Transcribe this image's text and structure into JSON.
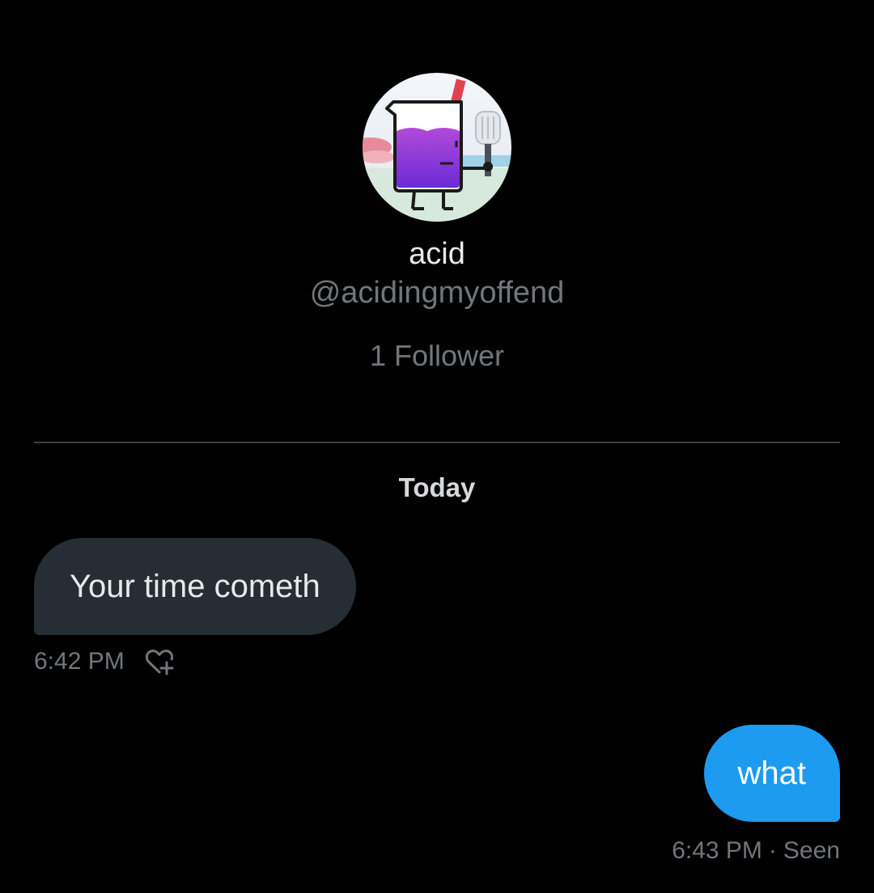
{
  "profile": {
    "avatar_icon": "beaker-character-avatar",
    "display_name": "acid",
    "handle": "@acidingmyoffend",
    "followers": "1 Follower"
  },
  "conversation": {
    "date_separator": "Today",
    "messages": [
      {
        "direction": "incoming",
        "text": "Your time cometh",
        "time": "6:42 PM",
        "reaction_icon": "add-reaction-heart-icon"
      },
      {
        "direction": "outgoing",
        "text": "what",
        "time": "6:43 PM",
        "separator": "·",
        "status": "Seen"
      }
    ]
  },
  "colors": {
    "background": "#000000",
    "incoming_bubble": "#262d34",
    "outgoing_bubble": "#1d9bf0",
    "secondary_text": "#71767b",
    "primary_text": "#e7e9ea"
  }
}
